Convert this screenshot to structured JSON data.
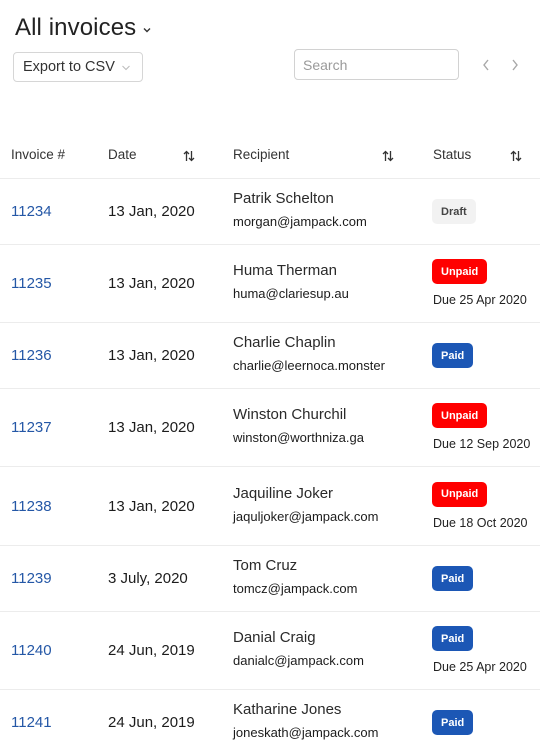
{
  "header": {
    "title": "All invoices",
    "export_label": "Export to CSV",
    "search_placeholder": "Search",
    "search_value": ""
  },
  "colors": {
    "link": "#2457a6",
    "unpaid": "#ff0000",
    "paid": "#1c57b5",
    "draft_bg": "#f2f2f2"
  },
  "table": {
    "columns": [
      {
        "label": "Invoice #",
        "sortable": false
      },
      {
        "label": "Date",
        "sortable": true
      },
      {
        "label": "Recipient",
        "sortable": true
      },
      {
        "label": "Status",
        "sortable": true
      }
    ],
    "rows": [
      {
        "invoice": "11234",
        "date": "13 Jan, 2020",
        "name": "Patrik Schelton",
        "email": "morgan@jampack.com",
        "status": "Draft",
        "status_type": "draft",
        "due": ""
      },
      {
        "invoice": "11235",
        "date": "13 Jan, 2020",
        "name": "Huma Therman",
        "email": "huma@clariesup.au",
        "status": "Unpaid",
        "status_type": "unpaid",
        "due": "Due 25 Apr 2020"
      },
      {
        "invoice": "11236",
        "date": "13 Jan, 2020",
        "name": "Charlie Chaplin",
        "email": "charlie@leernoca.monster",
        "status": "Paid",
        "status_type": "paid",
        "due": ""
      },
      {
        "invoice": "11237",
        "date": "13 Jan, 2020",
        "name": "Winston Churchil",
        "email": "winston@worthniza.ga",
        "status": "Unpaid",
        "status_type": "unpaid",
        "due": "Due 12 Sep 2020"
      },
      {
        "invoice": "11238",
        "date": "13 Jan, 2020",
        "name": "Jaquiline Joker",
        "email": "jaquljoker@jampack.com",
        "status": "Unpaid",
        "status_type": "unpaid",
        "due": "Due 18 Oct 2020"
      },
      {
        "invoice": "11239",
        "date": "3 July, 2020",
        "name": "Tom Cruz",
        "email": "tomcz@jampack.com",
        "status": "Paid",
        "status_type": "paid",
        "due": ""
      },
      {
        "invoice": "11240",
        "date": "24 Jun, 2019",
        "name": "Danial Craig",
        "email": "danialc@jampack.com",
        "status": "Paid",
        "status_type": "paid",
        "due": "Due 25 Apr 2020"
      },
      {
        "invoice": "11241",
        "date": "24 Jun, 2019",
        "name": "Katharine Jones",
        "email": "joneskath@jampack.com",
        "status": "Paid",
        "status_type": "paid",
        "due": ""
      }
    ]
  }
}
